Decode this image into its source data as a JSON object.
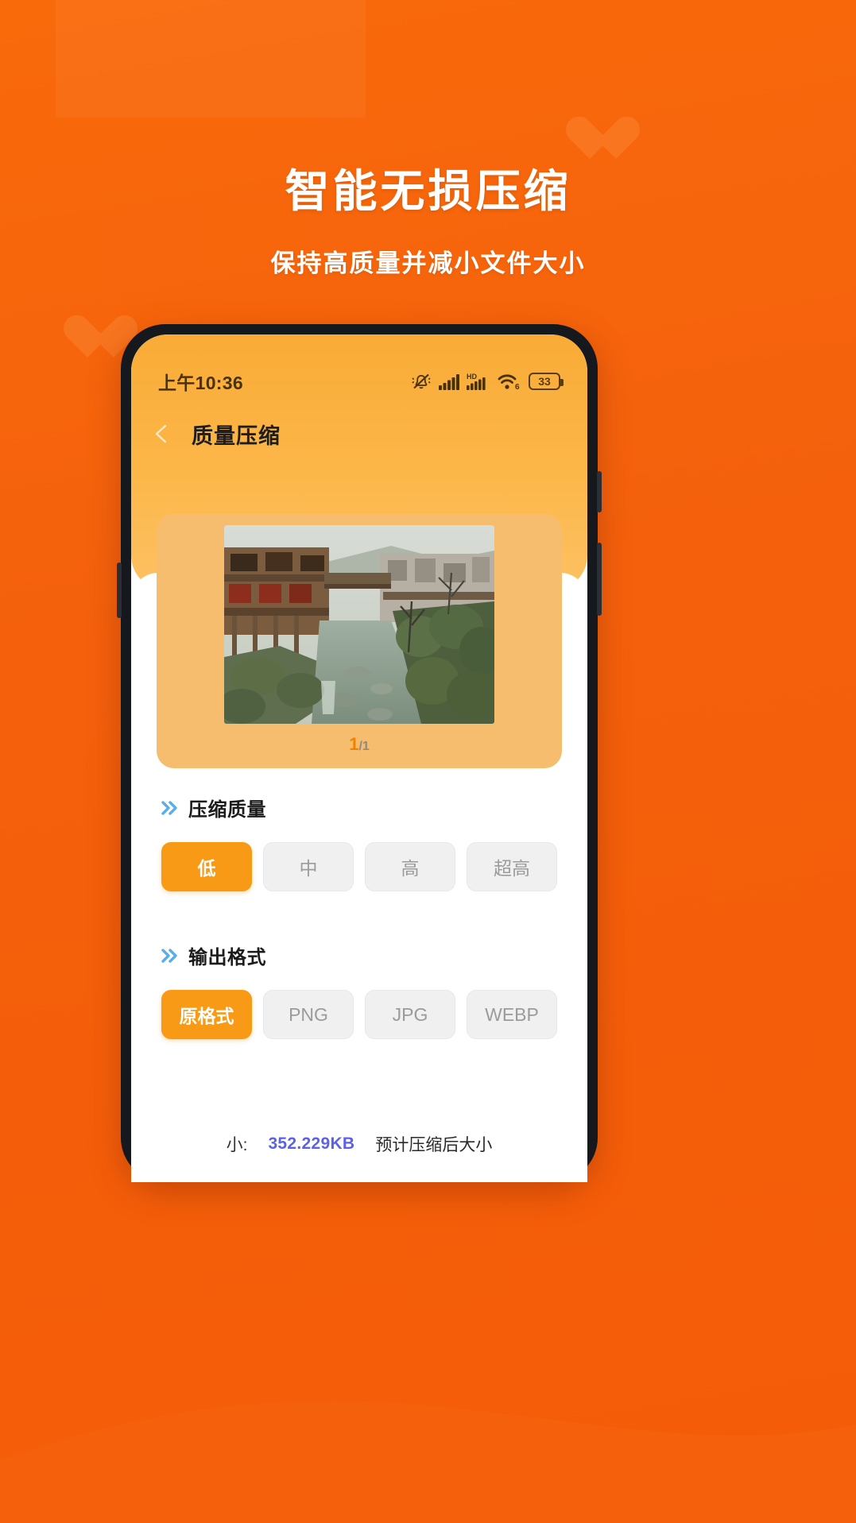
{
  "promo": {
    "title": "智能无损压缩",
    "subtitle": "保持高质量并减小文件大小",
    "bg_color": "#f4600c",
    "title_color": "#ffffff"
  },
  "phone": {
    "status_bar": {
      "time": "上午10:36",
      "icons": [
        "mute-bell-icon",
        "signal-bars-icon",
        "hd-signal-icon",
        "wifi6-icon"
      ],
      "battery_level": "33"
    },
    "nav": {
      "back_icon": "back-arrow-icon",
      "title": "质量压缩"
    },
    "preview": {
      "image_alt": "古镇河道风景照片",
      "page_current": "1",
      "page_total": "/1"
    },
    "quality_section": {
      "icon": "double-chevron-icon",
      "title": "压缩质量",
      "options": [
        {
          "label": "低",
          "selected": true
        },
        {
          "label": "中",
          "selected": false
        },
        {
          "label": "高",
          "selected": false
        },
        {
          "label": "超高",
          "selected": false
        }
      ]
    },
    "format_section": {
      "icon": "double-chevron-icon",
      "title": "输出格式",
      "options": [
        {
          "label": "原格式",
          "selected": true
        },
        {
          "label": "PNG",
          "selected": false
        },
        {
          "label": "JPG",
          "selected": false
        },
        {
          "label": "WEBP",
          "selected": false
        }
      ]
    },
    "info_strip": {
      "size_prefix": "小:",
      "size_value": "352.229KB",
      "estimate_label": "预计压缩后大小"
    },
    "accent_color": "#f89a16",
    "header_color": "#fcb749",
    "chevron_color": "#5aaee8"
  }
}
